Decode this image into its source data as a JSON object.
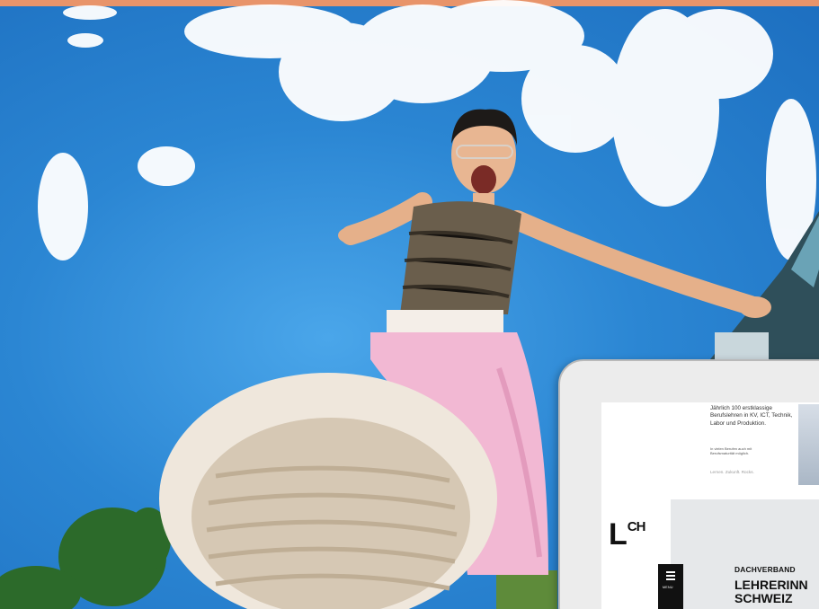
{
  "colors": {
    "top_bar": "#e8946a",
    "sky": "#2a86d2",
    "trousers": "#f2b8d3",
    "shoe_sole": "#d6c8b4"
  },
  "tablet_ad": {
    "headline": "Jährlich 100 erstklassige Berufslehren in KV, ICT, Technik, Labor und Produktion.",
    "note": "In vielen Berufen auch mit Berufsmaturität möglich.",
    "tags": "Lernen. Zukunft. Rocks.",
    "logo_main": "L",
    "logo_sup": "CH",
    "menu_label": "MENU",
    "kicker": "DACHVERBAND",
    "title_line1": "LEHRERINN",
    "title_line2": "SCHWEIZ"
  }
}
